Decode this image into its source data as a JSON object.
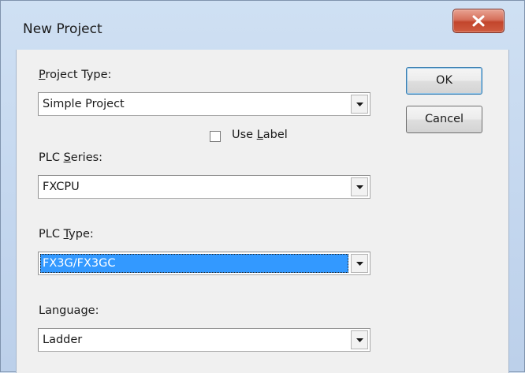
{
  "window": {
    "title": "New Project",
    "close_icon": "close-icon"
  },
  "form": {
    "project_type": {
      "label_pre": "",
      "label_key": "P",
      "label_post": "roject Type:",
      "value": "Simple Project"
    },
    "use_label": {
      "label_pre": "Use ",
      "label_key": "L",
      "label_post": "abel",
      "checked": false
    },
    "plc_series": {
      "label_pre": "PLC ",
      "label_key": "S",
      "label_post": "eries:",
      "value": "FXCPU"
    },
    "plc_type": {
      "label_pre": "PLC ",
      "label_key": "T",
      "label_post": "ype:",
      "value": "FX3G/FX3GC"
    },
    "language": {
      "label_pre": "Langua",
      "label_key": "g",
      "label_post": "e:",
      "value": "Ladder"
    }
  },
  "buttons": {
    "ok": "OK",
    "cancel": "Cancel"
  },
  "colors": {
    "selection": "#3399ff",
    "close_button": "#c2452c"
  }
}
